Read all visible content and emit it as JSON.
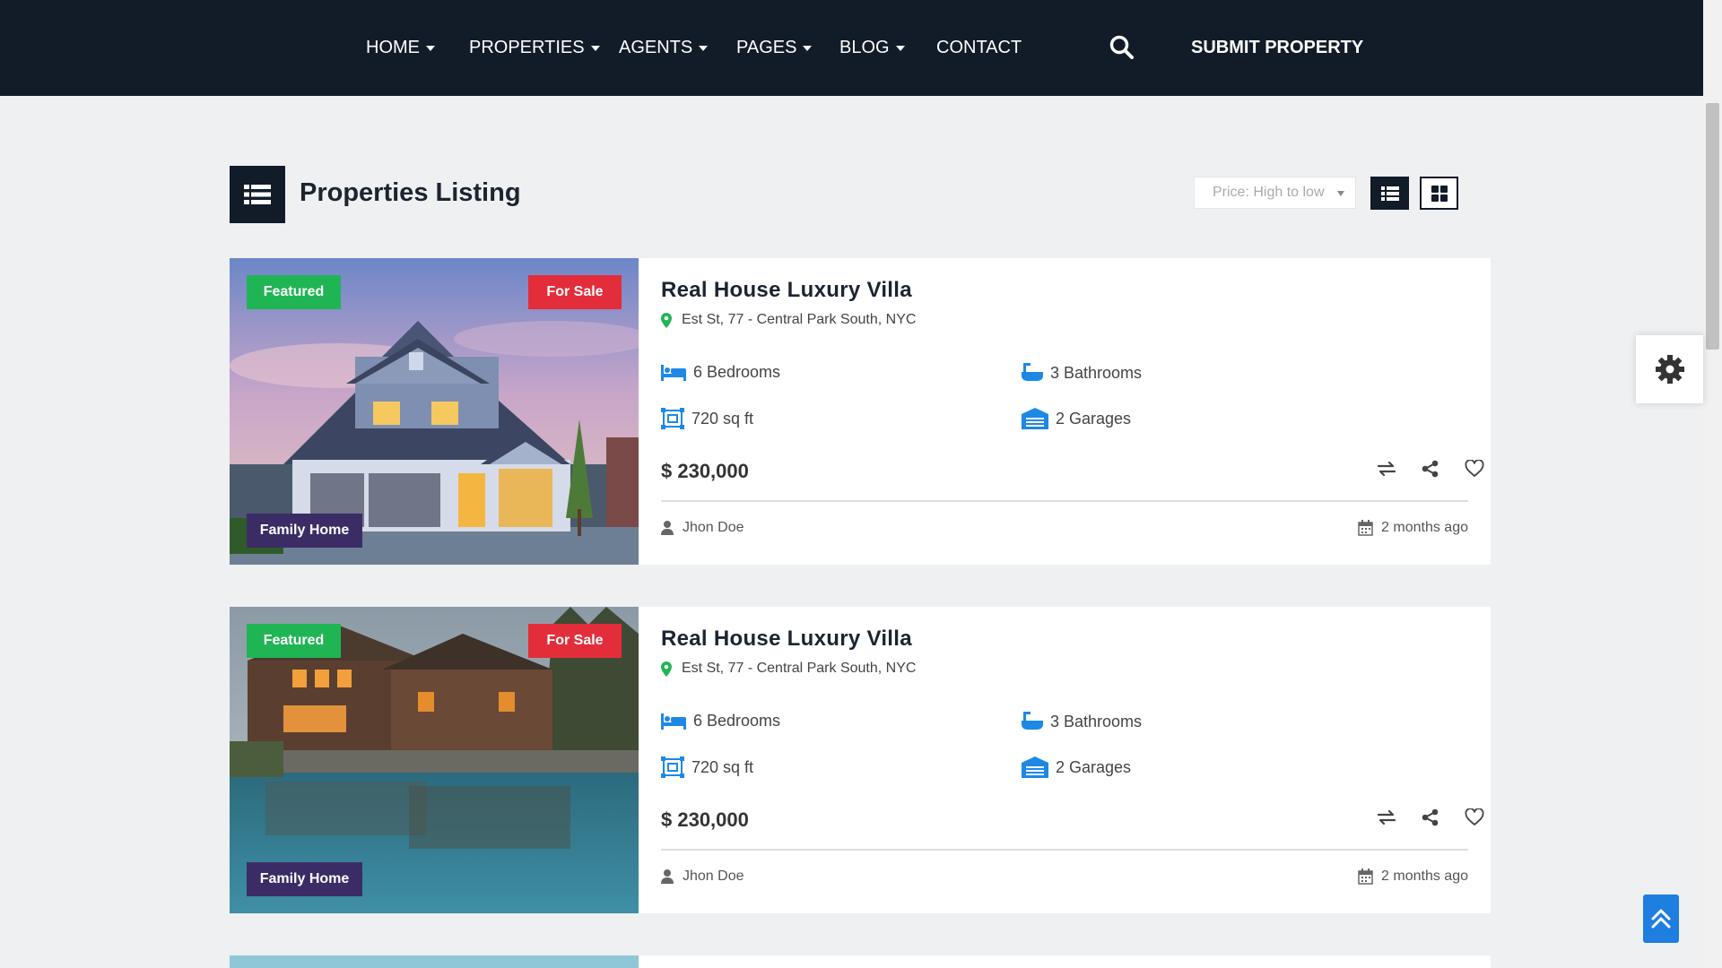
{
  "nav": {
    "items": [
      {
        "label": "HOME",
        "dropdown": true
      },
      {
        "label": "PROPERTIES",
        "dropdown": true
      },
      {
        "label": "AGENTS",
        "dropdown": true
      },
      {
        "label": "PAGES",
        "dropdown": true
      },
      {
        "label": "BLOG",
        "dropdown": true
      },
      {
        "label": "CONTACT",
        "dropdown": false
      }
    ],
    "search_icon": "search-icon",
    "submit_label": "SUBMIT PROPERTY"
  },
  "listing": {
    "title": "Properties Listing",
    "sort_value": "Price: High to low",
    "view_mode": "list"
  },
  "cards": [
    {
      "badge_featured": "Featured",
      "badge_status": "For Sale",
      "badge_type": "Family Home",
      "title": "Real House Luxury Villa",
      "address": "Est St, 77 - Central Park South, NYC",
      "bedrooms": "6 Bedrooms",
      "bathrooms": "3 Bathrooms",
      "area": "720 sq ft",
      "garages": "2 Garages",
      "price": "$ 230,000",
      "agent": "Jhon Doe",
      "posted": "2 months ago"
    },
    {
      "badge_featured": "Featured",
      "badge_status": "For Sale",
      "badge_type": "Family Home",
      "title": "Real House Luxury Villa",
      "address": "Est St, 77 - Central Park South, NYC",
      "bedrooms": "6 Bedrooms",
      "bathrooms": "3 Bathrooms",
      "area": "720 sq ft",
      "garages": "2 Garages",
      "price": "$ 230,000",
      "agent": "Jhon Doe",
      "posted": "2 months ago"
    }
  ],
  "colors": {
    "nav_bg": "#121b28",
    "featured": "#20b554",
    "for_sale": "#e32d3b",
    "family_home": "#3b2c66",
    "accent_blue": "#1f7fe0",
    "icon_blue": "#1e88e5",
    "location_green": "#20b554"
  }
}
